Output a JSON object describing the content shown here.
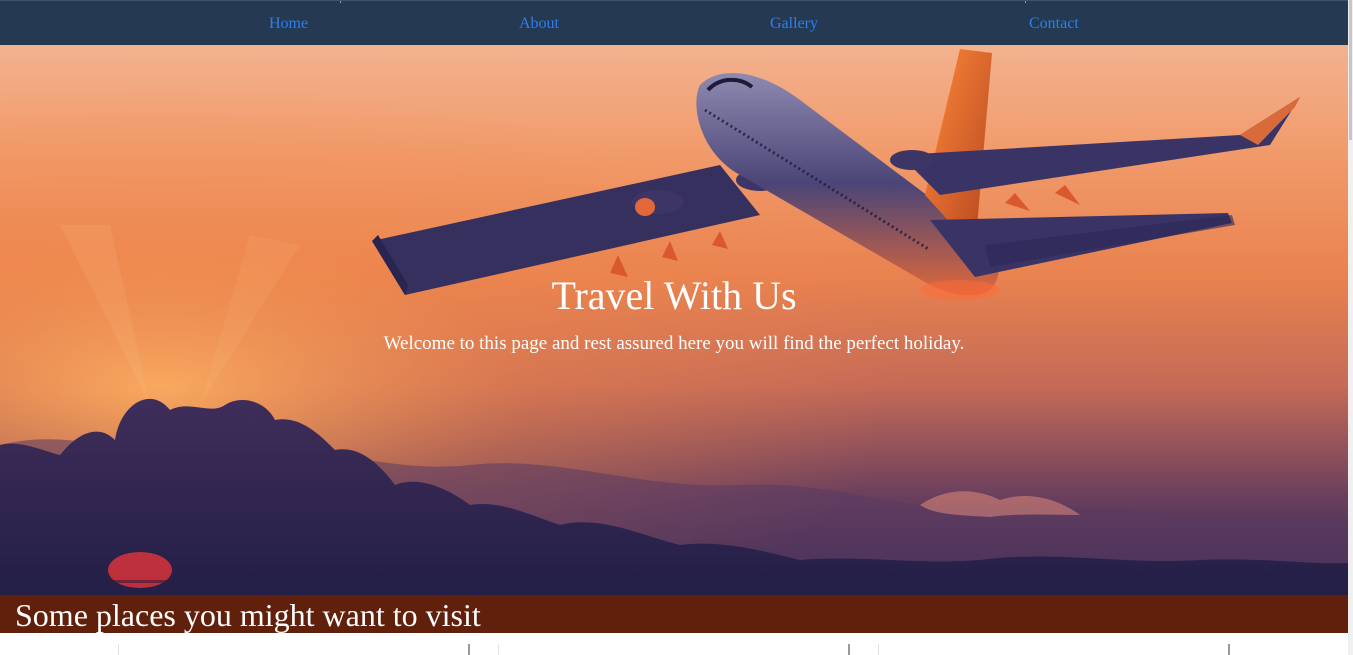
{
  "nav": {
    "items": [
      {
        "label": "Home"
      },
      {
        "label": "About"
      },
      {
        "label": "Gallery"
      },
      {
        "label": "Contact"
      }
    ]
  },
  "hero": {
    "title": "Travel With Us",
    "subtitle": "Welcome to this page and rest assured here you will find the perfect holiday."
  },
  "places": {
    "heading": "Some places you might want to visit"
  },
  "colors": {
    "nav_background": "#253a52",
    "nav_link": "#2b7ff0",
    "section_band": "#61200c",
    "hero_text": "#ffffff"
  },
  "icons": {
    "hero_image": "airplane-sunset-image"
  }
}
